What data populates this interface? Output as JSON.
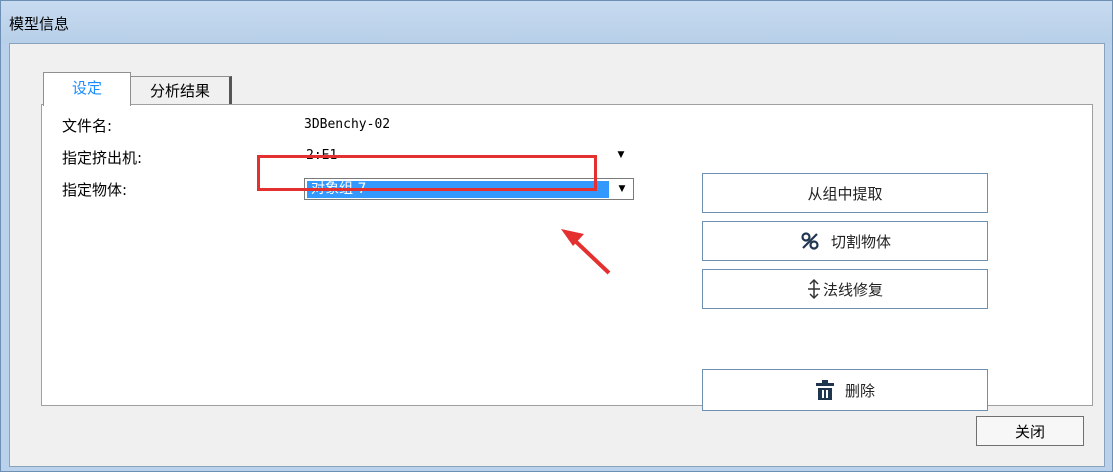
{
  "window": {
    "title": "模型信息"
  },
  "tabs": [
    {
      "label": "设定",
      "active": true
    },
    {
      "label": "分析结果",
      "active": false
    }
  ],
  "form": {
    "file_name_label": "文件名:",
    "file_name_value": "3DBenchy-02",
    "extruder_label": "指定挤出机:",
    "extruder_value": "2:E1",
    "object_label": "指定物体:",
    "object_value": "对象组 7"
  },
  "actions": {
    "extract_label": "从组中提取",
    "cut_label": "切割物体",
    "normal_fix_label": "法线修复",
    "delete_label": "删除"
  },
  "footer": {
    "close_label": "关闭"
  },
  "colors": {
    "tab_active_text": "#1a8cff",
    "selection": "#3399ff",
    "annotation": "#e53030"
  },
  "icons": {
    "cut": "scissors-cut-icon",
    "normal_fix": "vertical-arrows-icon",
    "delete": "trash-icon",
    "dropdown": "chevron-down-icon"
  }
}
